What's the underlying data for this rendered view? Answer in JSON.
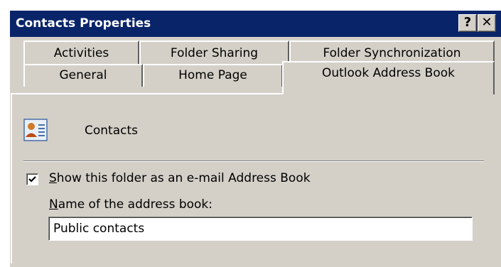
{
  "window": {
    "title": "Contacts Properties",
    "help_button": "?",
    "close_button": "✕"
  },
  "tabs": {
    "row1": [
      "Activities",
      "Folder Sharing",
      "Folder Synchronization"
    ],
    "row2": [
      "General",
      "Home Page",
      "Outlook Address Book"
    ],
    "active": "Outlook Address Book"
  },
  "content": {
    "folder_name": "Contacts",
    "folder_icon": "contacts-card-icon",
    "checkbox": {
      "label_accel": "S",
      "label_rest": "how this folder as an e-mail Address Book",
      "checked": true
    },
    "name_field": {
      "label_accel": "N",
      "label_rest": "ame of the address book:",
      "value": "Public contacts"
    }
  },
  "colors": {
    "titlebar": "#0a246a",
    "face": "#d4d0c8"
  }
}
